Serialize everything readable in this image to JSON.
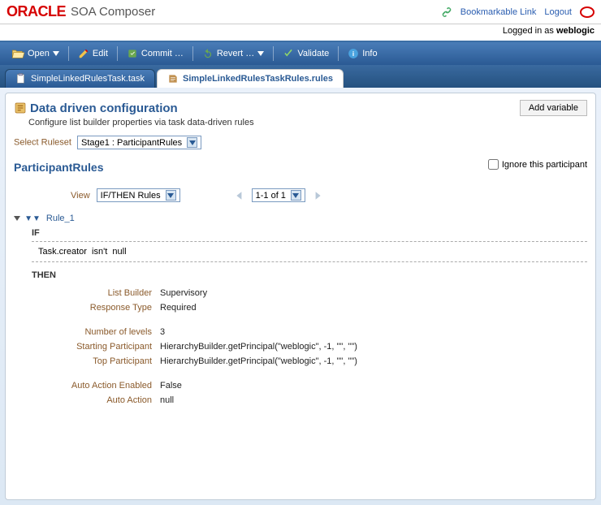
{
  "header": {
    "brand": "ORACLE",
    "product": "SOA Composer",
    "bookmark": "Bookmarkable Link",
    "logout": "Logout",
    "logged_in_prefix": "Logged in as ",
    "user": "weblogic"
  },
  "toolbar": {
    "open": "Open",
    "edit": "Edit",
    "commit": "Commit …",
    "revert": "Revert …",
    "validate": "Validate",
    "info": "Info"
  },
  "tabs": [
    {
      "label": "SimpleLinkedRulesTask.task",
      "active": false
    },
    {
      "label": "SimpleLinkedRulesTaskRules.rules",
      "active": true
    }
  ],
  "page": {
    "title": "Data driven configuration",
    "subtitle": "Configure list builder properties via task data-driven rules",
    "add_variable": "Add variable",
    "select_ruleset_label": "Select Ruleset",
    "select_ruleset_value": "Stage1 : ParticipantRules",
    "section_title": "ParticipantRules",
    "ignore_label": "Ignore this participant",
    "view_label": "View",
    "view_value": "IF/THEN Rules",
    "pager": "1-1 of 1"
  },
  "rule": {
    "name": "Rule_1",
    "if_kw": "IF",
    "then_kw": "THEN",
    "cond_subject": "Task.creator",
    "cond_op": "isn't",
    "cond_value": "null",
    "props": [
      {
        "label": "List Builder",
        "value": "Supervisory"
      },
      {
        "label": "Response Type",
        "value": "Required"
      },
      {
        "spacer": true
      },
      {
        "label": "Number of levels",
        "value": "3"
      },
      {
        "label": "Starting Participant",
        "value": "HierarchyBuilder.getPrincipal(\"weblogic\", -1, \"\", \"\")"
      },
      {
        "label": "Top Participant",
        "value": "HierarchyBuilder.getPrincipal(\"weblogic\", -1, \"\", \"\")"
      },
      {
        "spacer": true
      },
      {
        "label": "Auto Action Enabled",
        "value": "False"
      },
      {
        "label": "Auto Action",
        "value": "null"
      }
    ]
  }
}
